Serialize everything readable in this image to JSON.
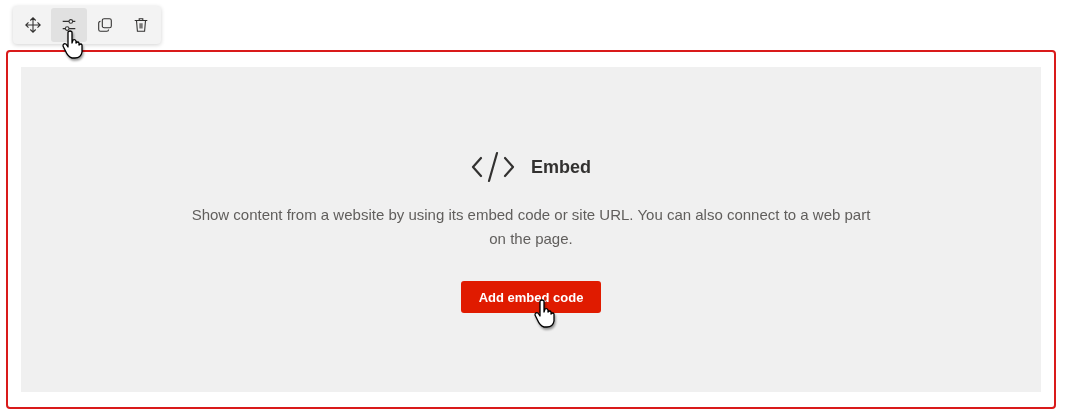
{
  "toolbar": {
    "buttons": [
      {
        "kind": "move",
        "selected": false
      },
      {
        "kind": "settings",
        "selected": true
      },
      {
        "kind": "duplicate",
        "selected": false
      },
      {
        "kind": "delete",
        "selected": false
      }
    ]
  },
  "web_part": {
    "selected": true,
    "title": "Embed",
    "description": "Show content from a website by using its embed code or site URL. You can also connect to a web part on the page.",
    "button": "Add embed code"
  }
}
